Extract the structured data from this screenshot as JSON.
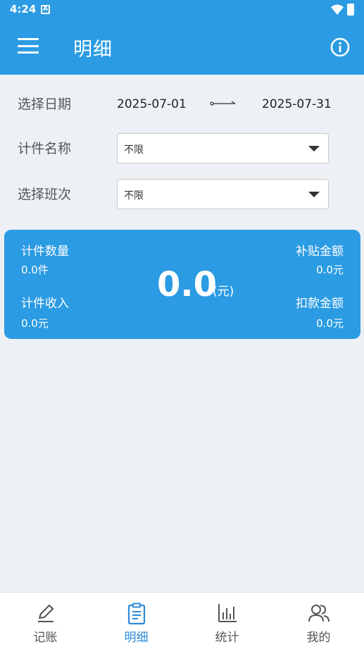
{
  "status_bar": {
    "time": "4:24",
    "notification_glyph": "A"
  },
  "app_bar": {
    "title": "明细",
    "menu_icon": "hamburger-menu-icon",
    "info_icon": "info-icon"
  },
  "filters": {
    "date": {
      "label": "选择日期",
      "start": "2025-07-01",
      "end": "2025-07-31"
    },
    "item_name": {
      "label": "计件名称",
      "selected": "不限"
    },
    "shift": {
      "label": "选择班次",
      "selected": "不限"
    }
  },
  "summary": {
    "piece_count_label": "计件数量",
    "piece_count_value": "0.0件",
    "piece_income_label": "计件收入",
    "piece_income_value": "0.0元",
    "total_value": "0.0",
    "total_unit": "(元)",
    "subsidy_label": "补贴金额",
    "subsidy_value": "0.0元",
    "deduction_label": "扣款金额",
    "deduction_value": "0.0元"
  },
  "tabs": [
    {
      "label": "记账",
      "icon": "pencil-icon",
      "active": false
    },
    {
      "label": "明细",
      "icon": "clipboard-icon",
      "active": true
    },
    {
      "label": "统计",
      "icon": "bar-chart-icon",
      "active": false
    },
    {
      "label": "我的",
      "icon": "users-icon",
      "active": false
    }
  ],
  "colors": {
    "primary": "#2b9be3",
    "active_tab": "#2b8ad8",
    "background": "#edf1f6"
  }
}
